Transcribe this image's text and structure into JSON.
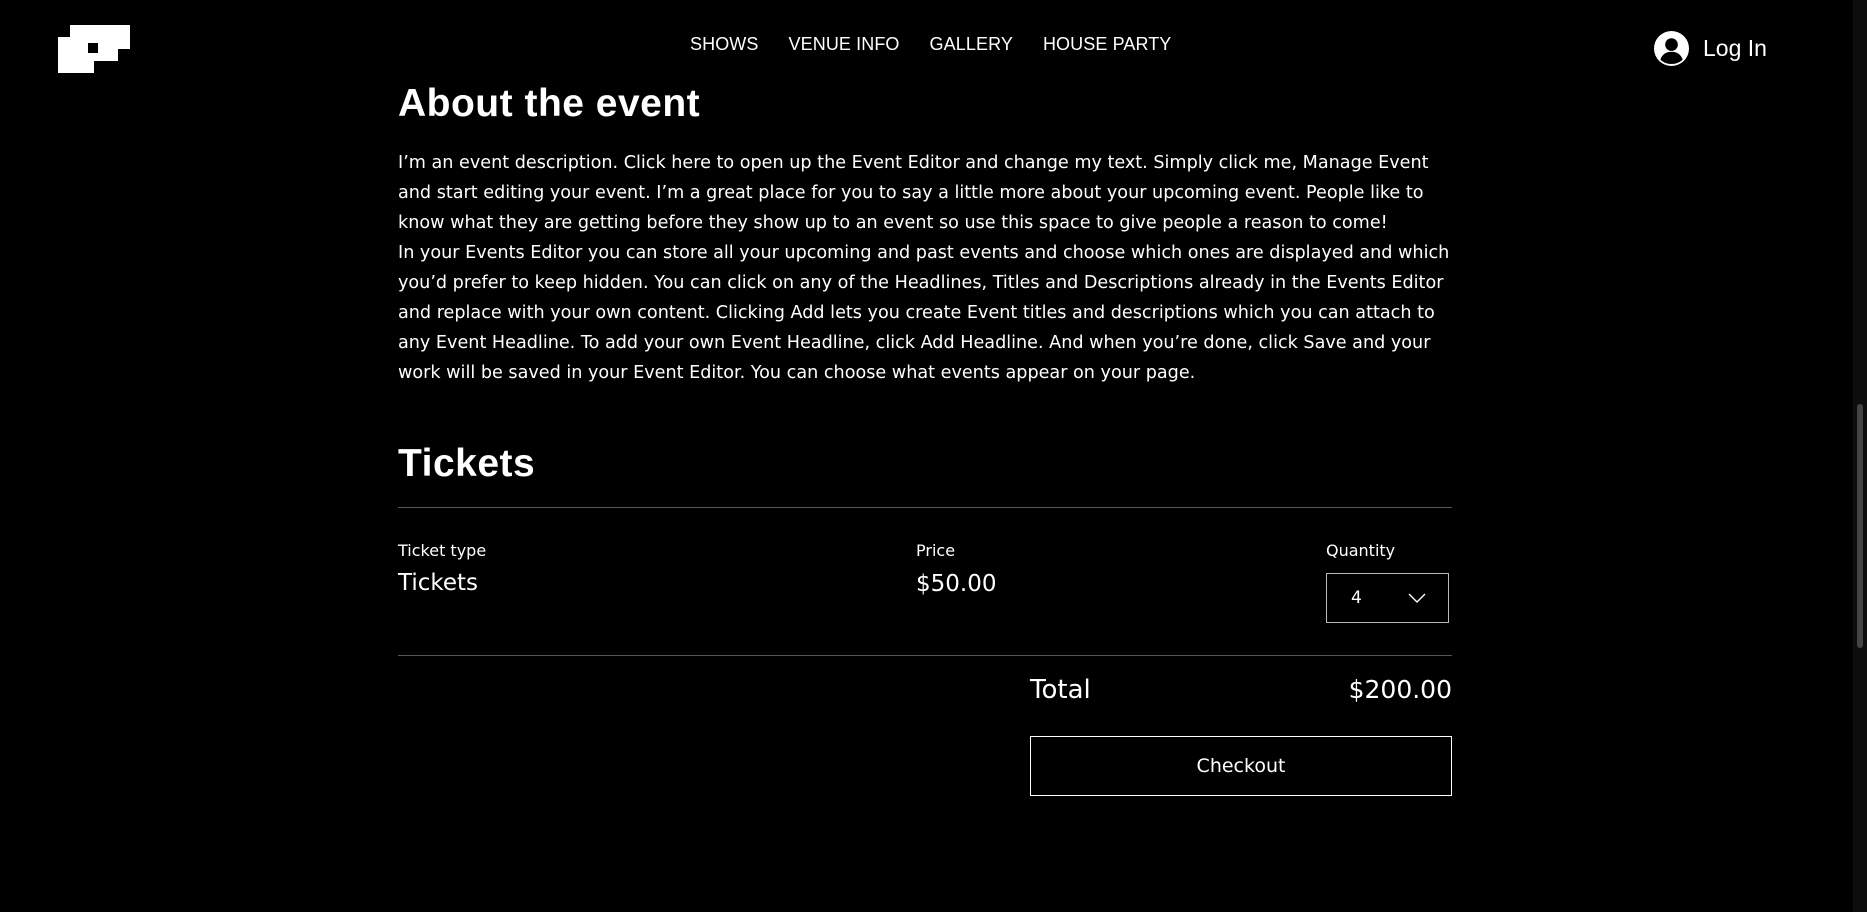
{
  "header": {
    "logo_icon": "pixel-logo-icon",
    "nav": [
      {
        "label": "SHOWS"
      },
      {
        "label": "VENUE INFO"
      },
      {
        "label": "GALLERY"
      },
      {
        "label": "HOUSE PARTY"
      }
    ],
    "login": {
      "label": "Log In",
      "icon": "user-avatar-icon"
    }
  },
  "about": {
    "heading": "About the event",
    "paragraphs": [
      "I’m an event description. Click here to open up the Event Editor and change my text. Simply click me, Manage Event and start editing your event. I’m a great place for you to say a little more about your upcoming event. People like to know what they are getting before they show up to an event so use this space to give people a reason to come!",
      "In your Events Editor you can store all your upcoming and past events and choose which ones are displayed and which you’d prefer to keep hidden. You can click on any of the Headlines, Titles and Descriptions already in the Events Editor and replace with your own content. Clicking Add lets you create Event titles and descriptions which you can attach to any Event Headline. To add your own Event Headline, click Add Headline. And when you’re done, click Save and your work will be saved in your Event Editor. You can choose what events appear on your page."
    ]
  },
  "tickets": {
    "heading": "Tickets",
    "columns": {
      "type_label": "Ticket type",
      "price_label": "Price",
      "quantity_label": "Quantity"
    },
    "row": {
      "type": "Tickets",
      "price": "$50.00",
      "quantity": "4"
    },
    "total_label": "Total",
    "total_value": "$200.00",
    "checkout_label": "Checkout"
  },
  "colors": {
    "background": "#000000",
    "text": "#ffffff",
    "divider": "#555555"
  }
}
